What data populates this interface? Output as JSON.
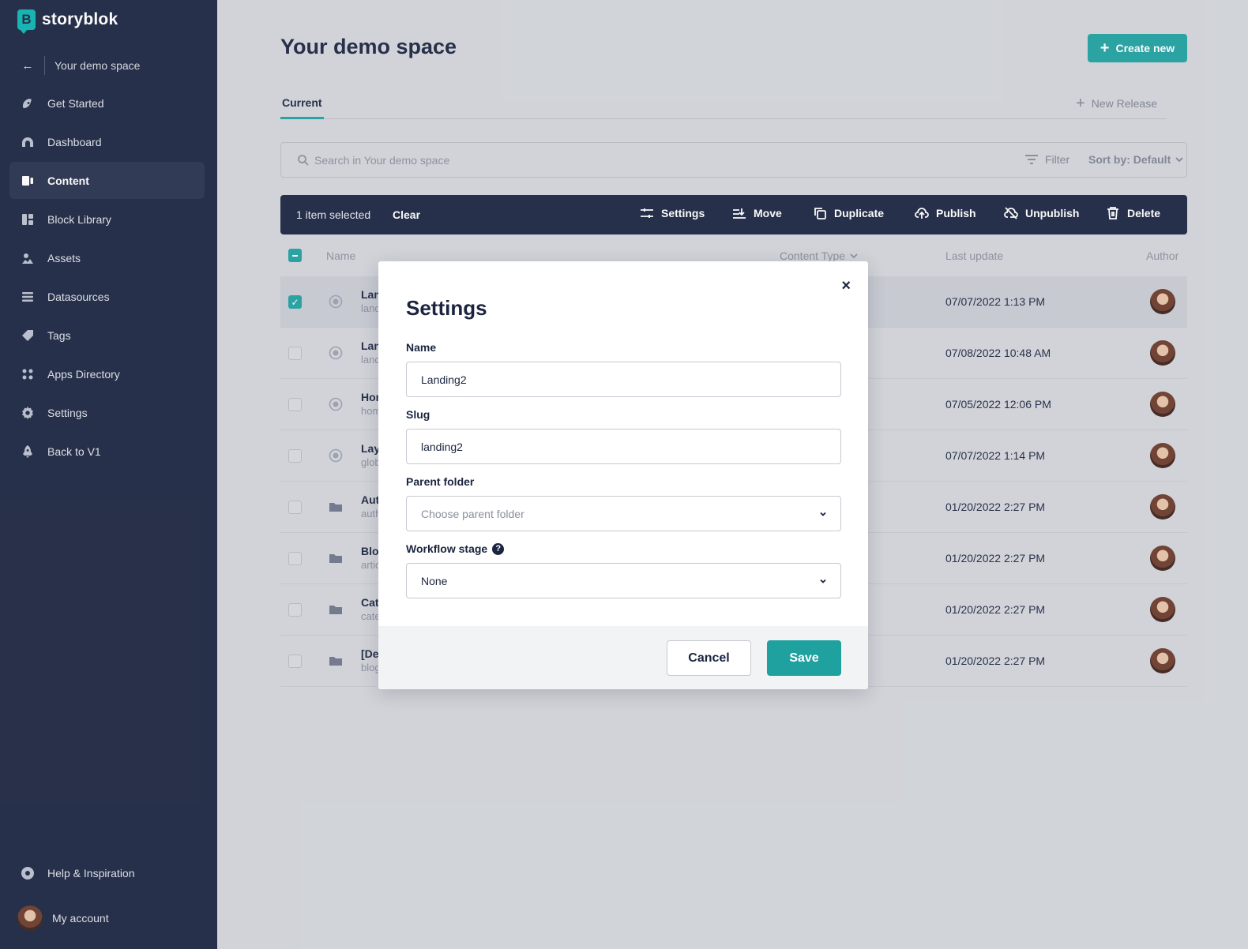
{
  "brand": {
    "name": "storyblok",
    "logo_letter": "B"
  },
  "sidebar": {
    "back_label": "Your demo space",
    "items": [
      {
        "label": "Get Started",
        "icon": "rocket-hand-icon"
      },
      {
        "label": "Dashboard",
        "icon": "dashboard-icon"
      },
      {
        "label": "Content",
        "icon": "content-icon",
        "active": true
      },
      {
        "label": "Block Library",
        "icon": "block-library-icon"
      },
      {
        "label": "Assets",
        "icon": "assets-icon"
      },
      {
        "label": "Datasources",
        "icon": "datasources-icon"
      },
      {
        "label": "Tags",
        "icon": "tag-icon"
      },
      {
        "label": "Apps Directory",
        "icon": "apps-icon"
      },
      {
        "label": "Settings",
        "icon": "gear-icon"
      },
      {
        "label": "Back to V1",
        "icon": "rocket-icon"
      }
    ],
    "help_label": "Help & Inspiration",
    "account_label": "My account"
  },
  "header": {
    "title": "Your demo space",
    "create_label": "Create new"
  },
  "tabs": {
    "current": "Current",
    "new_release": "New Release"
  },
  "search": {
    "placeholder": "Search in Your demo space",
    "filter_label": "Filter",
    "sort_label": "Sort by: Default"
  },
  "action_bar": {
    "selected": "1 item selected",
    "clear": "Clear",
    "actions": [
      "Settings",
      "Move",
      "Duplicate",
      "Publish",
      "Unpublish",
      "Delete"
    ]
  },
  "table": {
    "headers": {
      "name": "Name",
      "content_type": "Content Type",
      "last_update": "Last update",
      "author": "Author"
    },
    "rows": [
      {
        "name": "Lan",
        "slug": "land",
        "date": "07/07/2022 1:13 PM",
        "kind": "story",
        "checked": true
      },
      {
        "name": "Lan",
        "slug": "land",
        "date": "07/08/2022 10:48 AM",
        "kind": "story",
        "checked": false
      },
      {
        "name": "Hon",
        "slug": "hom",
        "date": "07/05/2022 12:06 PM",
        "kind": "story",
        "checked": false
      },
      {
        "name": "Lay",
        "slug": "glob",
        "date": "07/07/2022 1:14 PM",
        "kind": "story",
        "checked": false
      },
      {
        "name": "Aut",
        "slug": "auth",
        "date": "01/20/2022 2:27 PM",
        "kind": "folder",
        "checked": false
      },
      {
        "name": "Blog",
        "slug": "artic",
        "date": "01/20/2022 2:27 PM",
        "kind": "folder",
        "checked": false
      },
      {
        "name": "Cat",
        "slug": "cate",
        "date": "01/20/2022 2:27 PM",
        "kind": "folder",
        "checked": false
      },
      {
        "name": "[Dem",
        "slug": "blog",
        "date": "01/20/2022 2:27 PM",
        "kind": "folder",
        "checked": false
      }
    ]
  },
  "modal": {
    "title": "Settings",
    "name_label": "Name",
    "name_value": "Landing2",
    "slug_label": "Slug",
    "slug_value": "landing2",
    "parent_label": "Parent folder",
    "parent_placeholder": "Choose parent folder",
    "workflow_label": "Workflow stage",
    "workflow_value": "None",
    "help_glyph": "?",
    "close_glyph": "×",
    "cancel_label": "Cancel",
    "save_label": "Save"
  },
  "colors": {
    "sidebar": "#1b243f",
    "accent": "#1fa1a0",
    "background": "#d3d5da"
  }
}
